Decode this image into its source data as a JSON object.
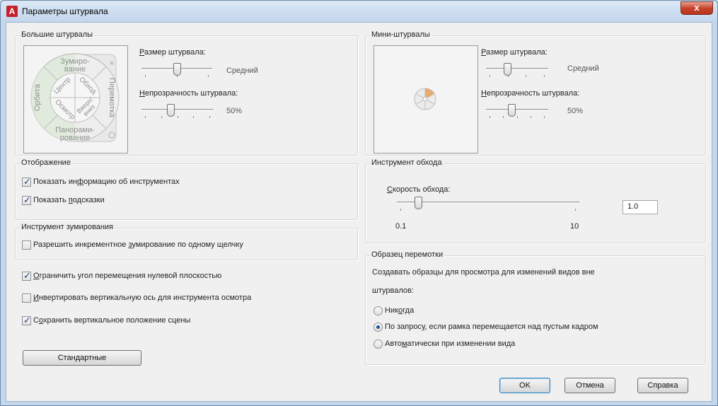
{
  "window": {
    "title": "Параметры штурвала",
    "close_icon_glyph": "x"
  },
  "big_wheels": {
    "title": "Большие штурвалы",
    "size_label": "Размер штурвала:",
    "size_value": "Средний",
    "size_level_fraction": 0.5,
    "opacity_label": "Непрозрачность штурвала:",
    "opacity_value": "50%",
    "opacity_level_fraction": 0.4,
    "wheel": {
      "zoom": [
        "Зумиро-",
        "вание"
      ],
      "rewind": "Перемотка",
      "pan": [
        "Панорами-",
        "рование"
      ],
      "orbit": "Орбита",
      "center": "Центр",
      "walk": "Обход",
      "look": "Осмотр",
      "updown": [
        "Вверх/",
        "вниз"
      ]
    }
  },
  "mini_wheels": {
    "title": "Мини-штурвалы",
    "size_label": "Размер штурвала:",
    "size_value": "Средний",
    "size_level_fraction": 0.33,
    "opacity_label": "Непрозрачность штурвала:",
    "opacity_value": "50%",
    "opacity_level_fraction": 0.4
  },
  "display": {
    "title": "Отображение",
    "show_tooltips_label": "Показать информацию об инструментах",
    "show_tooltips_checked": true,
    "show_hints_label": "Показать подсказки",
    "show_hints_checked": true
  },
  "zoom_tool": {
    "title": "Инструмент зумирования",
    "incremental_label": "Разрешить инкрементное зумирование по одному щелчку",
    "incremental_checked": false
  },
  "general": {
    "limit_angle_label": "Ограничить угол перемещения нулевой плоскостью",
    "limit_angle_checked": true,
    "invert_axis_label": "Инвертировать вертикальную ось для инструмента осмотра",
    "invert_axis_checked": false,
    "keep_vertical_label": "Сохранить вертикальное положение сцены",
    "keep_vertical_checked": true,
    "defaults_button": "Стандартные"
  },
  "walk_tool": {
    "title": "Инструмент обхода",
    "speed_label": "Скорость обхода:",
    "speed_min": "0.1",
    "speed_max": "10",
    "speed_value": "1.0",
    "speed_level_fraction": 0.1
  },
  "rewind_sample": {
    "title": "Образец перемотки",
    "description_line1": "Создавать образцы для просмотра для изменений видов вне",
    "description_line2": "штурвалов:",
    "option_never": "Никогда",
    "option_on_demand": "По запросу, если рамка перемещается над пустым кадром",
    "option_auto": "Автоматически при изменении вида",
    "selected": "on_demand"
  },
  "footer": {
    "ok": "OK",
    "cancel": "Отмена",
    "help": "Справка"
  },
  "colors": {
    "accent_orange": "#e8a15a",
    "wheel_green": "#cfe6c4"
  }
}
